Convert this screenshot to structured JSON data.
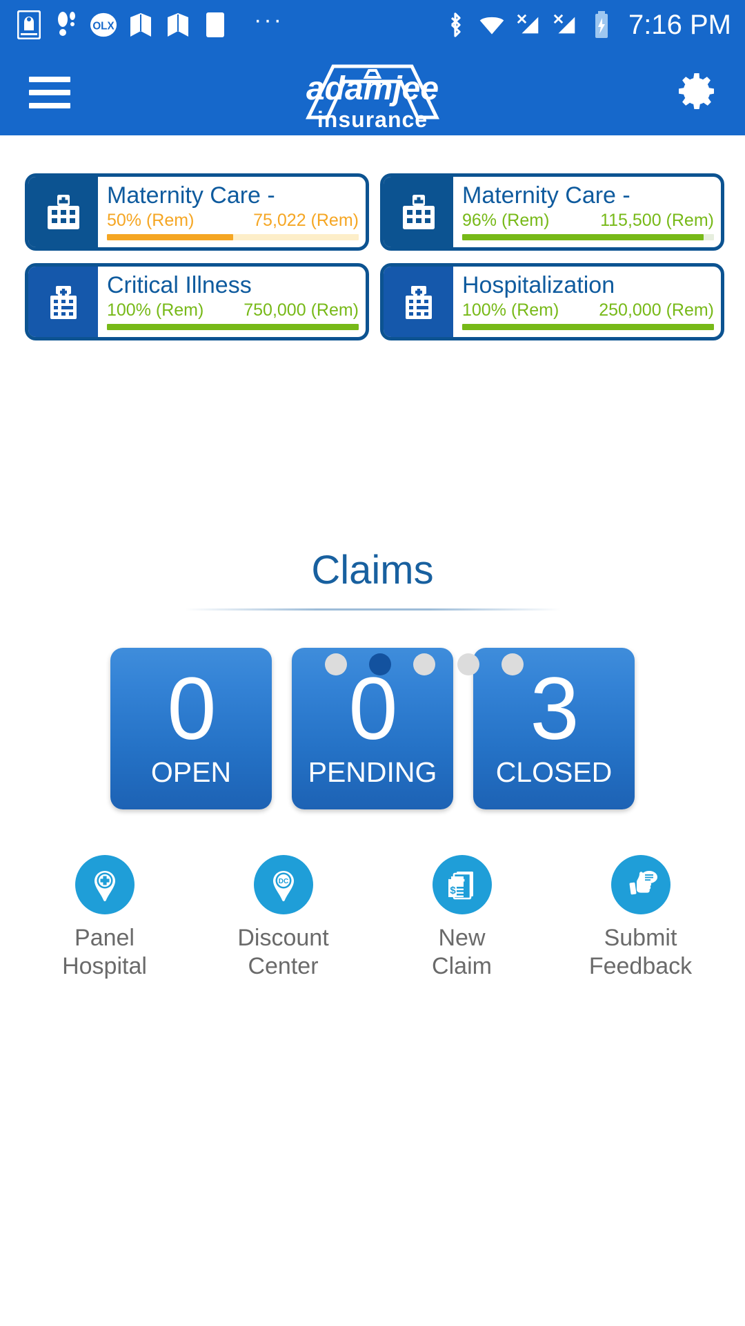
{
  "statusbar": {
    "time": "7:16 PM",
    "overflow": "···",
    "left_icons": [
      "prayer-app-icon",
      "step-counter-icon",
      "olx-icon",
      "book-icon",
      "book-icon",
      "blank-notification-icon"
    ],
    "right_icons": [
      "bluetooth-icon",
      "wifi-icon",
      "signal-1-icon",
      "signal-2-icon",
      "battery-charging-icon"
    ]
  },
  "appbar": {
    "menu_label": "menu",
    "brand_name": "adamjee",
    "brand_sub": "insurance",
    "settings_label": "settings"
  },
  "benefits": {
    "cards": [
      {
        "title": "Maternity Care -",
        "percent_text": "50% (Rem)",
        "amount_text": "75,022 (Rem)",
        "percent_value": 50,
        "color": "#f5a623",
        "track": "#fdeec9",
        "icon": "hospital-icon",
        "icon_bg": "#0c5391"
      },
      {
        "title": "Maternity Care -",
        "percent_text": "96% (Rem)",
        "amount_text": "115,500 (Rem)",
        "percent_value": 96,
        "color": "#77b918",
        "track": "#e6eede",
        "icon": "hospital-icon",
        "icon_bg": "#0c5391"
      },
      {
        "title": "Critical Illness",
        "percent_text": "100% (Rem)",
        "amount_text": "750,000 (Rem)",
        "percent_value": 100,
        "color": "#77b918",
        "track": "#e6eede",
        "icon": "hospital-icon",
        "icon_bg": "#1558ab"
      },
      {
        "title": "Hospitalization",
        "percent_text": "100% (Rem)",
        "amount_text": "250,000 (Rem)",
        "percent_value": 100,
        "color": "#77b918",
        "track": "#e6eede",
        "icon": "hospital-icon",
        "icon_bg": "#1558ab"
      }
    ]
  },
  "pager": {
    "count": 5,
    "active_index": 1
  },
  "claims": {
    "heading": "Claims",
    "tiles": [
      {
        "count": "0",
        "label": "OPEN"
      },
      {
        "count": "0",
        "label": "PENDING"
      },
      {
        "count": "3",
        "label": "CLOSED"
      }
    ]
  },
  "quick_actions": [
    {
      "label_line1": "Panel",
      "label_line2": "Hospital",
      "icon": "map-pin-hospital-icon"
    },
    {
      "label_line1": "Discount",
      "label_line2": "Center",
      "icon": "map-pin-dc-icon"
    },
    {
      "label_line1": "New",
      "label_line2": "Claim",
      "icon": "claim-document-icon"
    },
    {
      "label_line1": "Submit",
      "label_line2": "Feedback",
      "icon": "thumbs-up-feedback-icon"
    }
  ],
  "colors": {
    "brand_blue": "#1668cb",
    "dark_blue": "#0c5391",
    "accent_cyan": "#1f9ed8",
    "green": "#77b918",
    "orange": "#f5a623"
  }
}
